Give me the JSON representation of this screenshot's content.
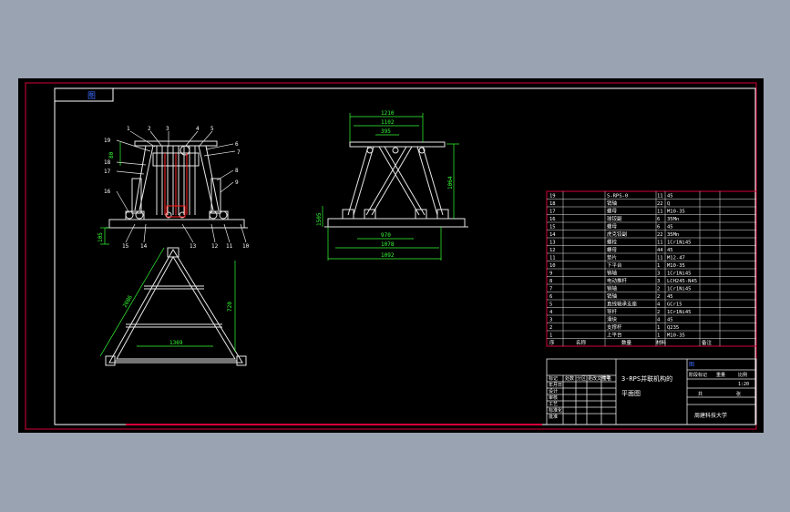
{
  "colors": {
    "background": "#9aa3b1",
    "canvas": "#000000",
    "frame": "#d6003a",
    "border": "#ffffff",
    "geometry": "#e8e8e8",
    "dimension": "#35ff35",
    "labels": "#ffffff",
    "title_tab": "#3b6cff",
    "highlight": "#ff2020"
  },
  "title_tab": {
    "text": "图"
  },
  "front_view": {
    "callouts_top": [
      "1",
      "2",
      "3",
      "4",
      "5"
    ],
    "callouts_left": [
      "19",
      "18",
      "17",
      "16"
    ],
    "callouts_right": [
      "6",
      "7",
      "8",
      "9"
    ],
    "callouts_bottom": [
      "15",
      "14",
      "13",
      "12",
      "11",
      "10"
    ],
    "dim_top": "80",
    "dim_base": "105"
  },
  "side_view": {
    "dim_top_outer": "1210",
    "dim_top_mid": "1102",
    "dim_top_inner": "395",
    "dim_height": "1064",
    "dim_base_left": "1505",
    "dim_base_inner": "970",
    "dim_base_mid": "1078",
    "dim_base_outer": "1092"
  },
  "top_view": {
    "dim_side": "2086",
    "dim_height": "720",
    "dim_bottom": "1369"
  },
  "bom": {
    "rows": [
      {
        "no": "19",
        "name": "S-RPS-0",
        "qty": "11",
        "mat": "45"
      },
      {
        "no": "18",
        "name": "销轴",
        "qty": "22",
        "mat": "Q"
      },
      {
        "no": "17",
        "name": "螺母",
        "qty": "11",
        "mat": "M10-35"
      },
      {
        "no": "16",
        "name": "球铰副",
        "qty": "6",
        "mat": "35Mn"
      },
      {
        "no": "15",
        "name": "螺母",
        "qty": "6",
        "mat": "45"
      },
      {
        "no": "14",
        "name": "虎克铰副",
        "qty": "22",
        "mat": "35Mn"
      },
      {
        "no": "13",
        "name": "螺栓",
        "qty": "11",
        "mat": "1Cr1Ni45"
      },
      {
        "no": "12",
        "name": "螺母",
        "qty": "44",
        "mat": "45"
      },
      {
        "no": "11",
        "name": "垫片",
        "qty": "11",
        "mat": "M12-47"
      },
      {
        "no": "10",
        "name": "下平台",
        "qty": "1",
        "mat": "M10-35"
      },
      {
        "no": "9",
        "name": "销轴",
        "qty": "3",
        "mat": "1Cr1Ni45"
      },
      {
        "no": "8",
        "name": "电动推杆",
        "qty": "3",
        "mat": "LCH245-N45"
      },
      {
        "no": "7",
        "name": "销轴",
        "qty": "2",
        "mat": "1Cr1Ni45"
      },
      {
        "no": "6",
        "name": "销轴",
        "qty": "2",
        "mat": "45"
      },
      {
        "no": "5",
        "name": "直线轴承支座",
        "qty": "4",
        "mat": "GCr15"
      },
      {
        "no": "4",
        "name": "导杆",
        "qty": "2",
        "mat": "1Cr1Ni45"
      },
      {
        "no": "3",
        "name": "滑块",
        "qty": "4",
        "mat": "45"
      },
      {
        "no": "2",
        "name": "支撑杆",
        "qty": "1",
        "mat": "Q235"
      },
      {
        "no": "1",
        "name": "上平台",
        "qty": "1",
        "mat": "M10-35"
      }
    ],
    "header": [
      "序",
      "名称",
      "数量",
      "材料"
    ],
    "header_extra": "备注"
  },
  "title_block": {
    "drawing_title_line1": "3-RPS并联机构的",
    "drawing_title_line2": "平面图",
    "school": "周建科技大学",
    "header_cells": [
      "标记",
      "处数",
      "分区",
      "更改文件号",
      "签名",
      "年月日"
    ],
    "left_rows": [
      "设计",
      "审核",
      "工艺",
      "标准化",
      "批准"
    ],
    "stage_label": "阶段标记",
    "weight_label": "重量",
    "scale_label": "比例",
    "scale": "1:20",
    "sheet_label": "共",
    "sheet_of": "张",
    "material_mark": "图"
  }
}
